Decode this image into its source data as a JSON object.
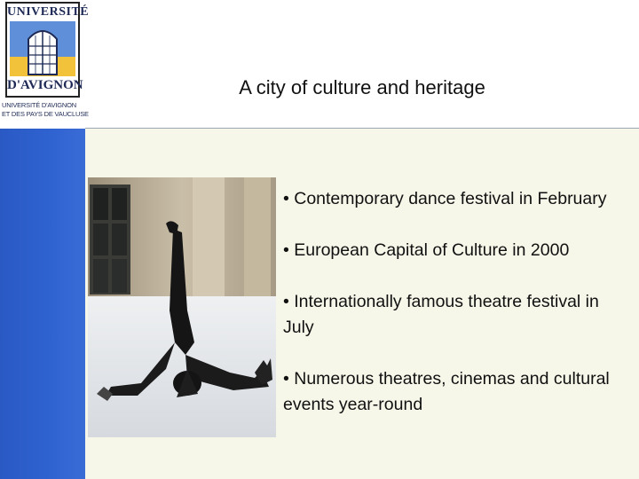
{
  "logo": {
    "top_text": "UNIVERSITÉ",
    "bottom_text": "D'AVIGNON",
    "sub_line1": "UNIVERSITÉ D'AVIGNON",
    "sub_line2": "ET DES PAYS DE VAUCLUSE"
  },
  "slide": {
    "title": "A city of culture and heritage",
    "bullets": [
      "• Contemporary dance festival in February",
      "• European Capital of Culture in 2000",
      "• Internationally famous theatre festival in July",
      "• Numerous theatres, cinemas and cultural events year-round"
    ]
  },
  "colors": {
    "sidebar": "#2f63d0",
    "content_background": "#f6f6e9",
    "logo_text": "#1e2a55"
  }
}
